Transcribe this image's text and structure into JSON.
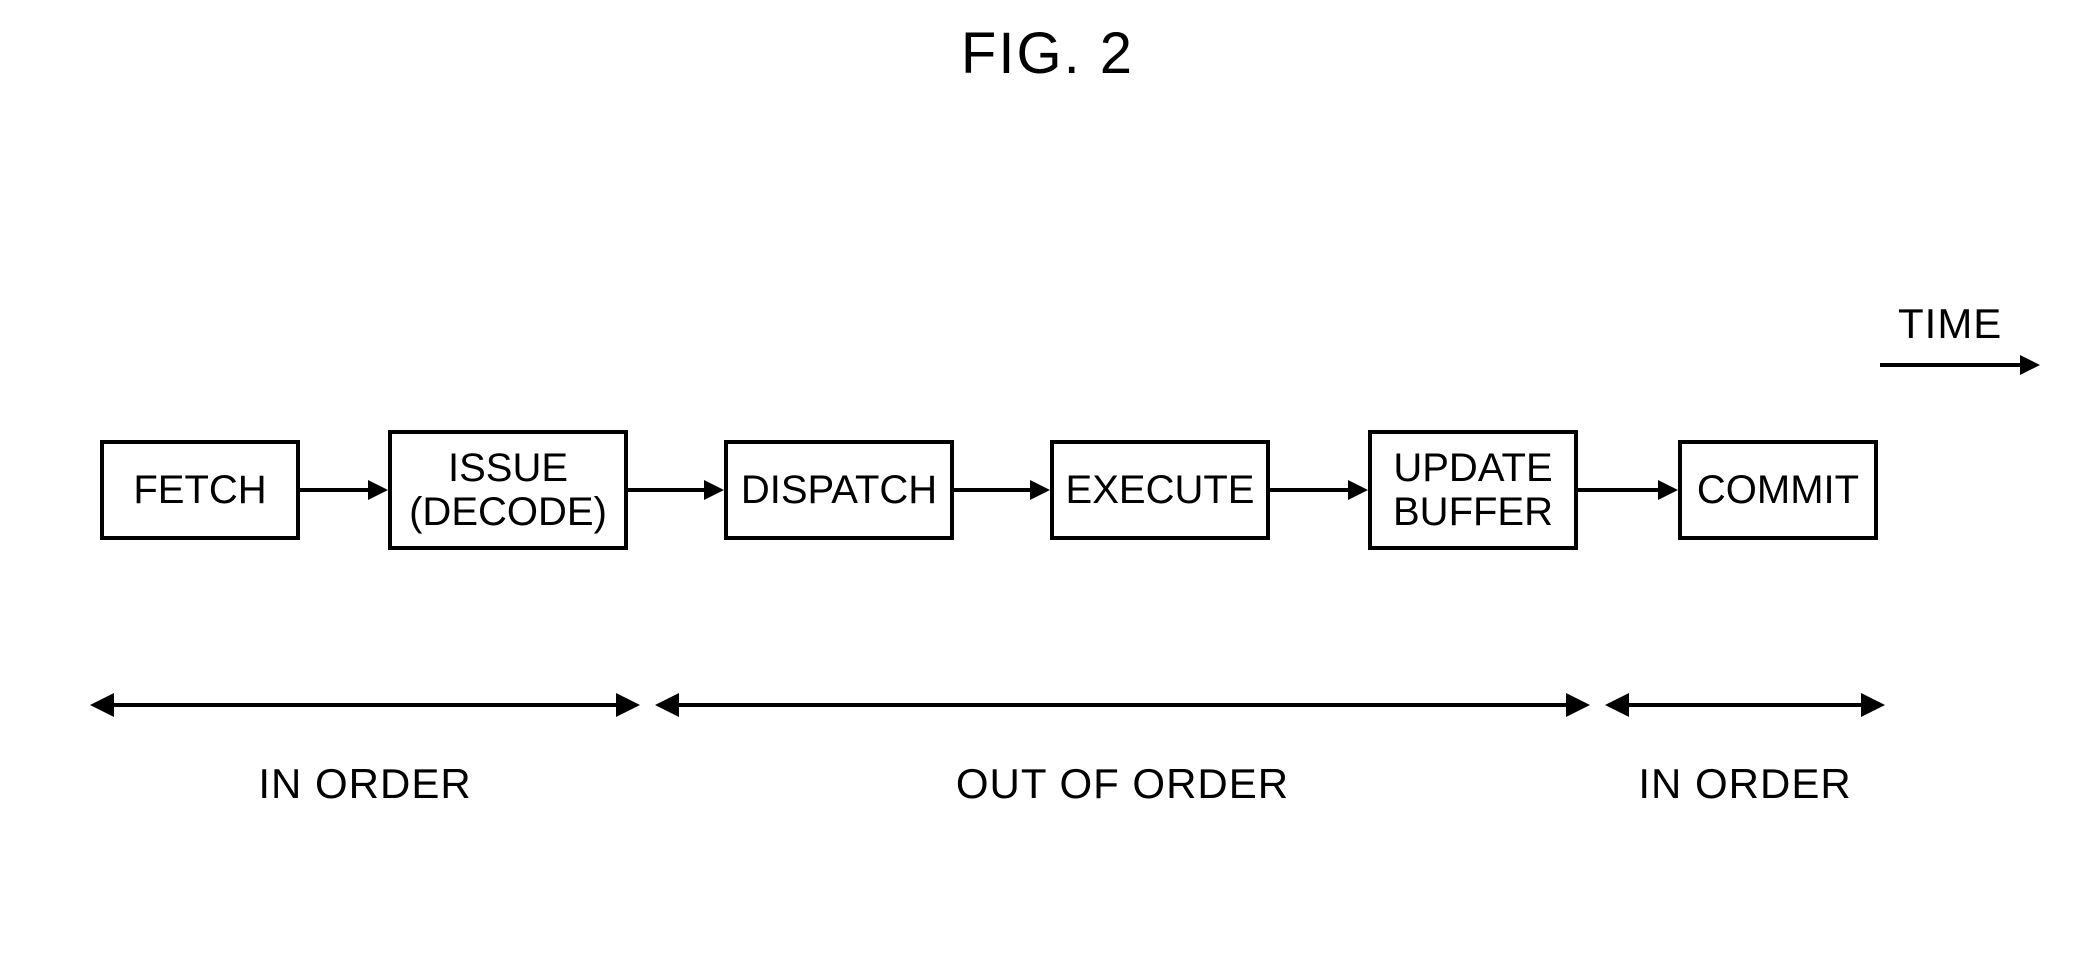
{
  "figure_title": "FIG. 2",
  "time_label": "TIME",
  "stages": {
    "fetch": "FETCH",
    "issue_line1": "ISSUE",
    "issue_line2": "(DECODE)",
    "dispatch": "DISPATCH",
    "execute": "EXECUTE",
    "update_line1": "UPDATE",
    "update_line2": "BUFFER",
    "commit": "COMMIT"
  },
  "ranges": {
    "in_order_left": "IN ORDER",
    "out_of_order": "OUT OF ORDER",
    "in_order_right": "IN ORDER"
  }
}
